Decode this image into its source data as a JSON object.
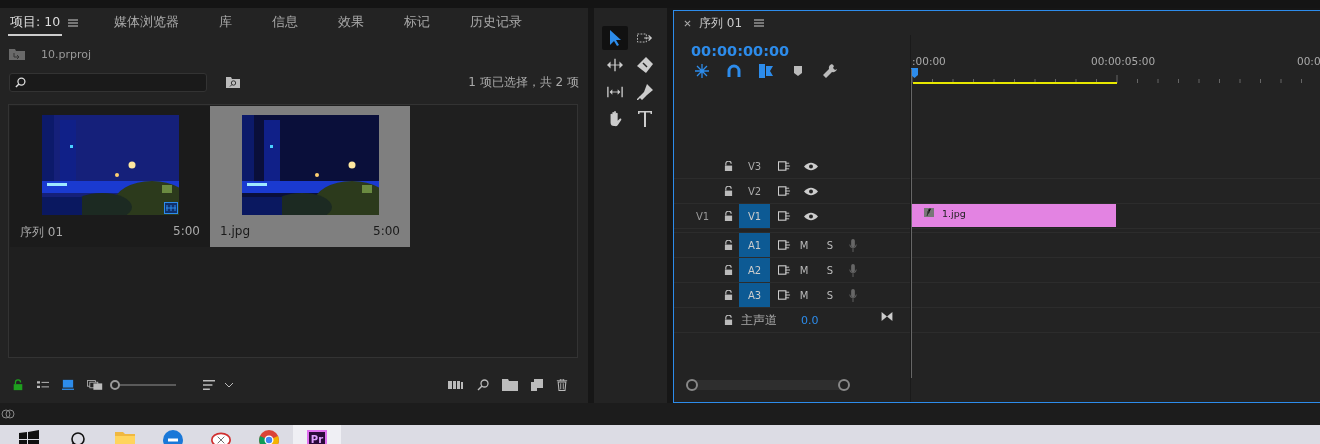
{
  "project_panel": {
    "tabs": [
      {
        "label": "项目: 10",
        "selected": true
      },
      {
        "label": "媒体浏览器",
        "selected": false
      },
      {
        "label": "库",
        "selected": false
      },
      {
        "label": "信息",
        "selected": false
      },
      {
        "label": "效果",
        "selected": false
      },
      {
        "label": "标记",
        "selected": false
      },
      {
        "label": "历史记录",
        "selected": false
      }
    ],
    "file": "10.prproj",
    "selection_status": "1 项已选择，共 2 项",
    "items": [
      {
        "name": "序列 01",
        "duration": "5:00",
        "kind": "sequence",
        "selected": false
      },
      {
        "name": "1.jpg",
        "duration": "5:00",
        "kind": "still",
        "selected": true
      }
    ],
    "zoom_slider": {
      "level": 0.0
    }
  },
  "timeline": {
    "title": "序列 01",
    "timecode": "00:00:00:00",
    "ruler_labels": [
      ":00:00",
      "00:00:05:00",
      "00:0"
    ],
    "tracks": [
      {
        "kind": "video",
        "name": "V3",
        "targeted": false
      },
      {
        "kind": "video",
        "name": "V2",
        "targeted": false
      },
      {
        "kind": "video",
        "source": "V1",
        "name": "V1",
        "targeted": true,
        "clip": {
          "name": "1.jpg"
        }
      },
      {
        "kind": "audio",
        "name": "A1",
        "targeted": true,
        "mute": "M",
        "solo": "S"
      },
      {
        "kind": "audio",
        "name": "A2",
        "targeted": true,
        "mute": "M",
        "solo": "S"
      },
      {
        "kind": "audio",
        "name": "A3",
        "targeted": true,
        "mute": "M",
        "solo": "S"
      }
    ],
    "master": {
      "name": "主声道",
      "value": "0.0"
    }
  },
  "taskbar": {
    "apps": [
      {
        "kind": "windows",
        "selected": false
      },
      {
        "kind": "search",
        "selected": false
      },
      {
        "kind": "folder",
        "selected": false
      },
      {
        "kind": "edge",
        "selected": false
      },
      {
        "kind": "app",
        "selected": false
      },
      {
        "kind": "chrome",
        "selected": false
      },
      {
        "kind": "premiere",
        "label": "Pr",
        "selected": true
      }
    ]
  }
}
